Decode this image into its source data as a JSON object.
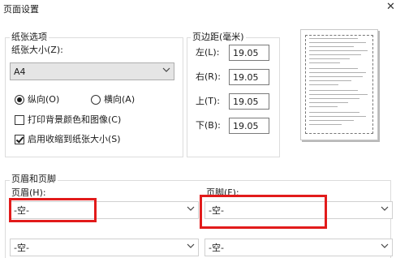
{
  "window": {
    "title": "页面设置",
    "close_symbol": "✕"
  },
  "paper_options": {
    "legend": "纸张选项",
    "size_label": "纸张大小(Z):",
    "size_value": "A4",
    "orientation": {
      "portrait_label": "纵向(O)",
      "landscape_label": "横向(A)",
      "selected": "portrait"
    },
    "print_background_label": "打印背景颜色和图像(C)",
    "print_background_checked": false,
    "shrink_to_fit_label": "启用收缩到纸张大小(S)",
    "shrink_to_fit_checked": true
  },
  "margins": {
    "legend": "页边距(毫米)",
    "left_label": "左(L):",
    "left_value": "19.05",
    "right_label": "右(R):",
    "right_value": "19.05",
    "top_label": "上(T):",
    "top_value": "19.05",
    "bottom_label": "下(B):",
    "bottom_value": "19.05"
  },
  "header_footer": {
    "legend": "页眉和页脚",
    "header_label": "页眉(H):",
    "header_value": "-空-",
    "footer_label": "页脚(F):",
    "footer_value": "-空-",
    "row2_left_value": "-空-",
    "row2_right_value": "-空-"
  },
  "highlight_color": "#e21b1b"
}
